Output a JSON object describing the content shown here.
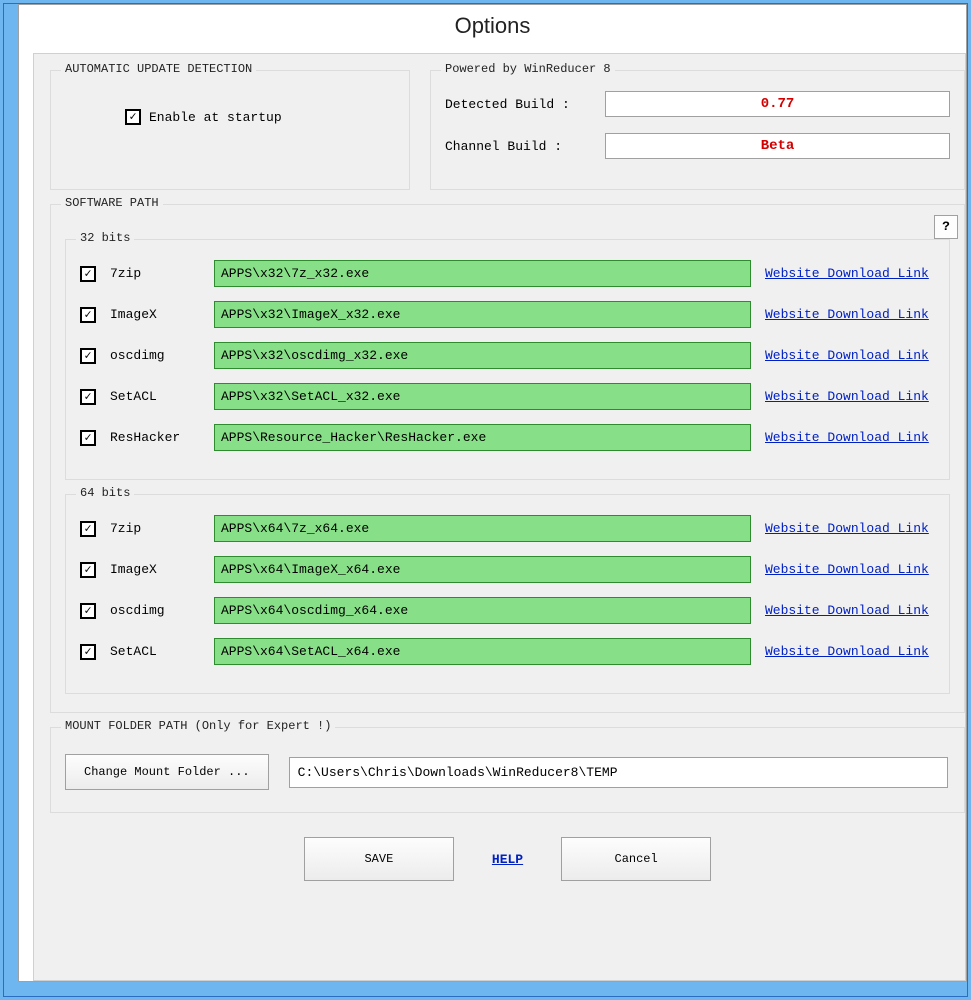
{
  "window": {
    "title": "Options"
  },
  "auto_update": {
    "legend": "AUTOMATIC UPDATE DETECTION",
    "enable_label": "Enable at startup",
    "enable_checked": "✓"
  },
  "powered": {
    "legend": "Powered by WinReducer 8",
    "detected_label": "Detected Build :",
    "detected_value": "0.77",
    "channel_label": "Channel Build :",
    "channel_value": "Beta"
  },
  "software": {
    "legend": "SOFTWARE PATH",
    "help": "?",
    "link_text": "Website Download Link",
    "bits32": {
      "legend": "32 bits",
      "rows": [
        {
          "name": "7zip",
          "path": "APPS\\x32\\7z_x32.exe"
        },
        {
          "name": "ImageX",
          "path": "APPS\\x32\\ImageX_x32.exe"
        },
        {
          "name": "oscdimg",
          "path": "APPS\\x32\\oscdimg_x32.exe"
        },
        {
          "name": "SetACL",
          "path": "APPS\\x32\\SetACL_x32.exe"
        },
        {
          "name": "ResHacker",
          "path": "APPS\\Resource_Hacker\\ResHacker.exe"
        }
      ]
    },
    "bits64": {
      "legend": "64 bits",
      "rows": [
        {
          "name": "7zip",
          "path": "APPS\\x64\\7z_x64.exe"
        },
        {
          "name": "ImageX",
          "path": "APPS\\x64\\ImageX_x64.exe"
        },
        {
          "name": "oscdimg",
          "path": "APPS\\x64\\oscdimg_x64.exe"
        },
        {
          "name": "SetACL",
          "path": "APPS\\x64\\SetACL_x64.exe"
        }
      ]
    }
  },
  "mount": {
    "legend": "MOUNT FOLDER PATH (Only for Expert !)",
    "button": "Change Mount Folder ...",
    "path": "C:\\Users\\Chris\\Downloads\\WinReducer8\\TEMP"
  },
  "buttons": {
    "save": "SAVE",
    "help": "HELP",
    "cancel": "Cancel"
  },
  "check_glyph": "✓"
}
